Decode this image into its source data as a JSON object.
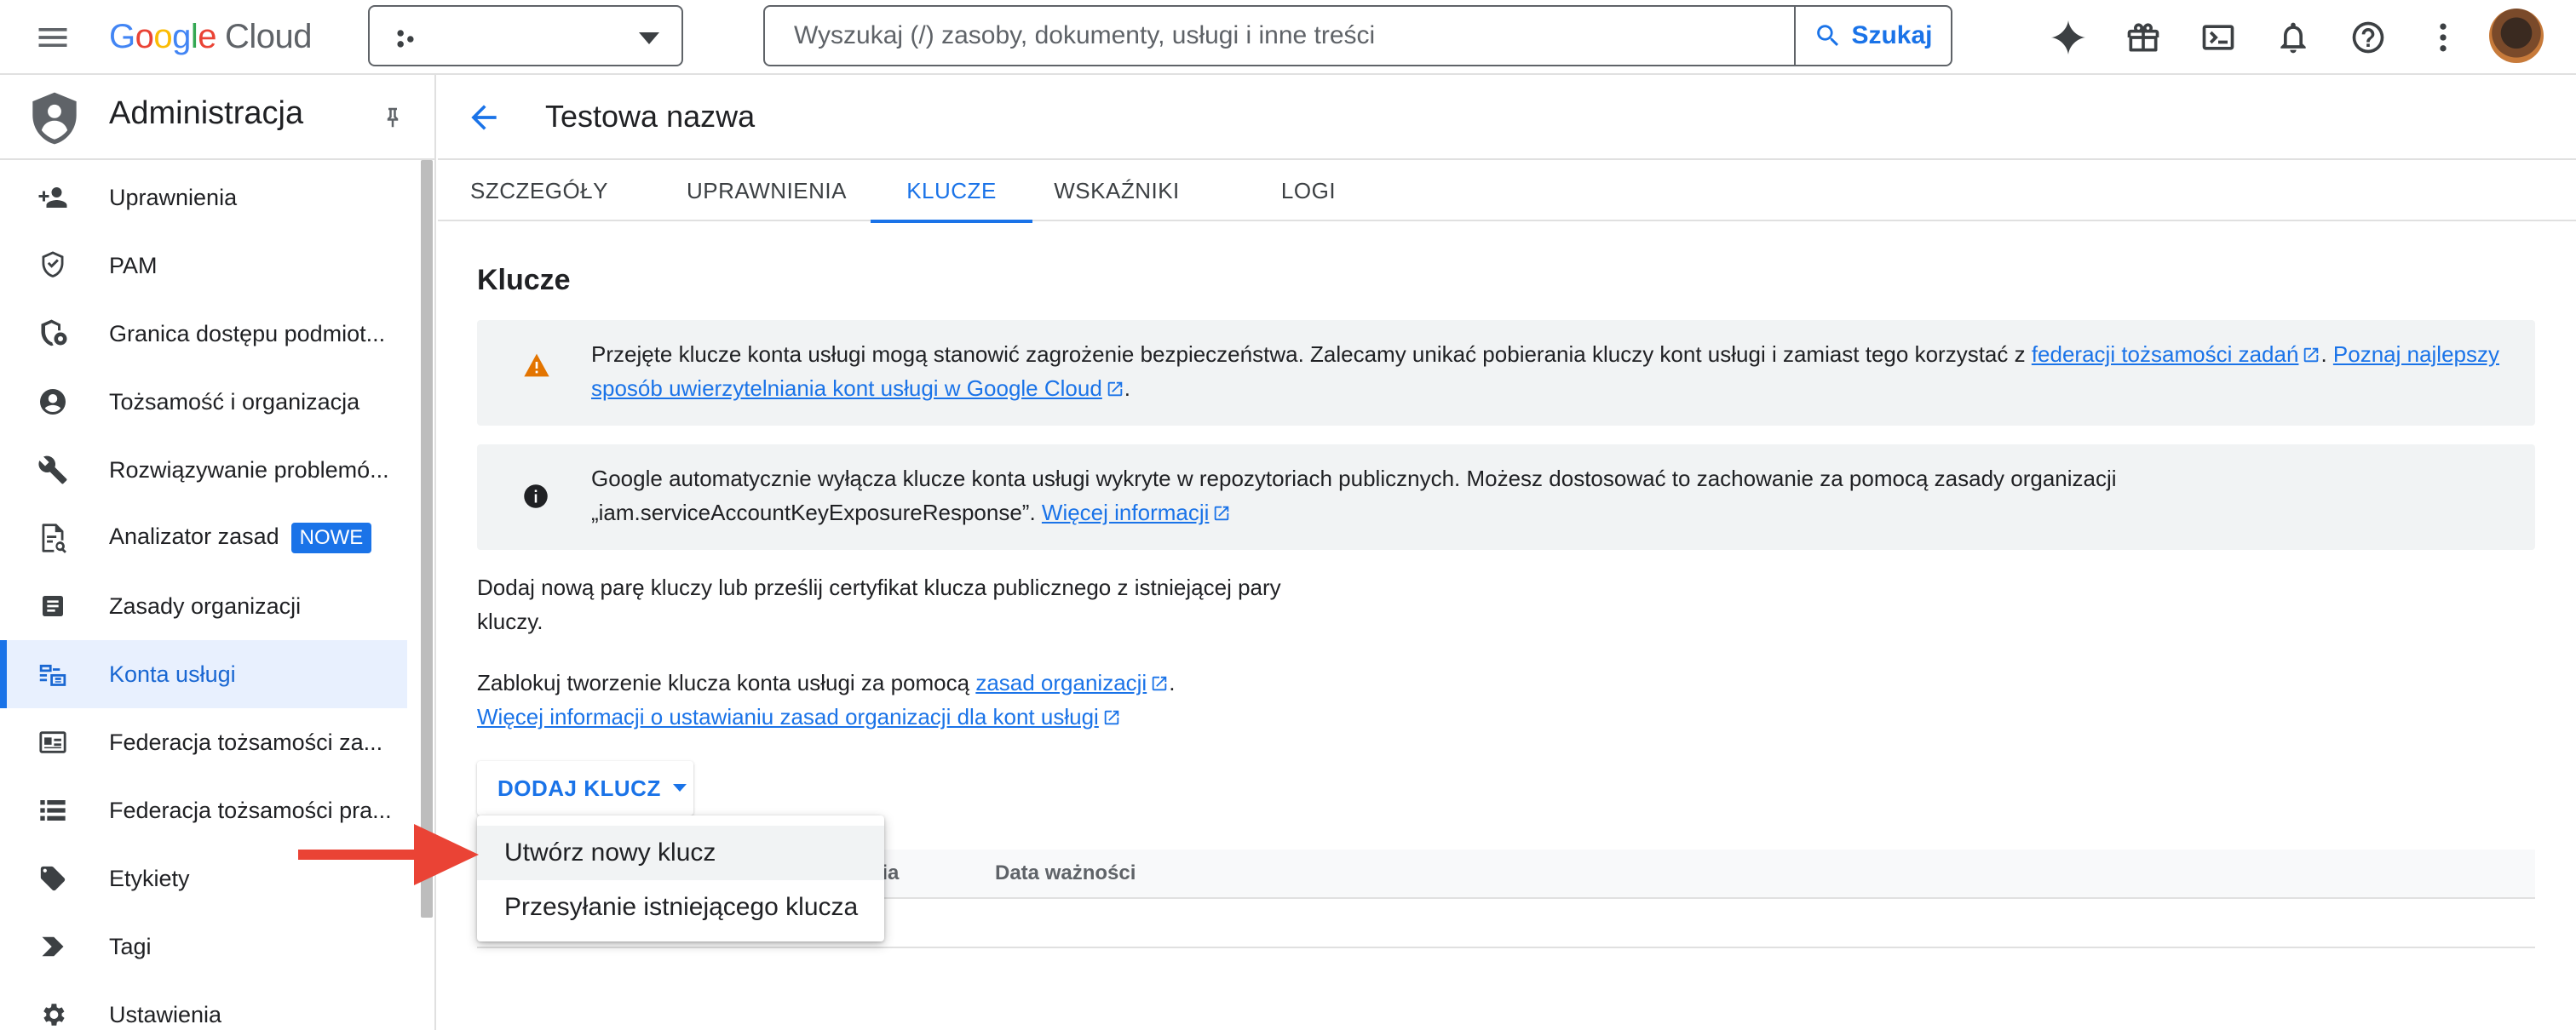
{
  "header": {
    "logo_word": "Google",
    "logo_cloud": "Cloud",
    "search_placeholder": "Wyszukaj (/) zasoby, dokumenty, usługi i inne treści",
    "search_button": "Szukaj",
    "icons": [
      "menu-icon",
      "project-icon",
      "chevron-down-icon",
      "search-icon",
      "gemini-spark-icon",
      "gift-icon",
      "terminal-icon",
      "bell-icon",
      "help-icon",
      "more-vert-icon"
    ]
  },
  "sidebar": {
    "title": "Administracja",
    "items": [
      {
        "label": "Uprawnienia",
        "icon": "person-add-icon"
      },
      {
        "label": "PAM",
        "icon": "shield-icon"
      },
      {
        "label": "Granica dostępu podmiot...",
        "icon": "shield-gear-icon"
      },
      {
        "label": "Tożsamość i organizacja",
        "icon": "account-circle-icon"
      },
      {
        "label": "Rozwiązywanie problemó...",
        "icon": "wrench-icon"
      },
      {
        "label": "Analizator zasad",
        "icon": "policy-doc-icon",
        "badge": "NOWE"
      },
      {
        "label": "Zasady organizacji",
        "icon": "article-icon"
      },
      {
        "label": "Konta usługi",
        "icon": "service-account-icon",
        "active": true
      },
      {
        "label": "Federacja tożsamości za...",
        "icon": "id-card-icon"
      },
      {
        "label": "Federacja tożsamości pra...",
        "icon": "list-icon"
      },
      {
        "label": "Etykiety",
        "icon": "tag-icon"
      },
      {
        "label": "Tagi",
        "icon": "label-arrow-icon"
      },
      {
        "label": "Ustawienia",
        "icon": "settings-icon"
      }
    ]
  },
  "page": {
    "title": "Testowa nazwa",
    "tabs": [
      "SZCZEGÓŁY",
      "UPRAWNIENIA",
      "KLUCZE",
      "WSKAŹNIKI",
      "LOGI"
    ],
    "active_tab": "KLUCZE",
    "section_title": "Klucze",
    "warning": {
      "text1": "Przejęte klucze konta usługi mogą stanowić zagrożenie bezpieczeństwa. Zalecamy unikać pobierania kluczy kont usługi i zamiast tego korzystać z ",
      "link1": "federacji tożsamości zadań",
      "text2": ". ",
      "link2a": "Poznaj najlepszy",
      "link2b": "sposób uwierzytelniania kont usługi w Google Cloud",
      "text3": "."
    },
    "info": {
      "line1": "Google automatycznie wyłącza klucze konta usługi wykryte w repozytoriach publicznych. Możesz dostosować to zachowanie za pomocą zasady organizacji",
      "line2": "„iam.serviceAccountKeyExposureResponse”. ",
      "link": "Więcej informacji"
    },
    "add_pair_text_1": "Dodaj nową parę kluczy lub prześlij certyfikat klucza publicznego z istniejącej pary",
    "add_pair_text_2": "kluczy.",
    "block_text": "Zablokuj tworzenie klucza konta usługi za pomocą ",
    "block_link": "zasad organizacji",
    "block_end": ".",
    "more_link": "Więcej informacji o ustawianiu zasad organizacji dla kont usługi",
    "add_key_button": "DODAJ KLUCZ",
    "table_headers": [
      "rzenia",
      "Data ważności"
    ],
    "dropdown_items": [
      "Utwórz nowy klucz",
      "Przesyłanie istniejącego klucza"
    ]
  },
  "colors": {
    "accent": "#1a73e8",
    "arrow": "#ea4335",
    "warning": "#e37400",
    "banner_bg": "#f1f3f4"
  }
}
